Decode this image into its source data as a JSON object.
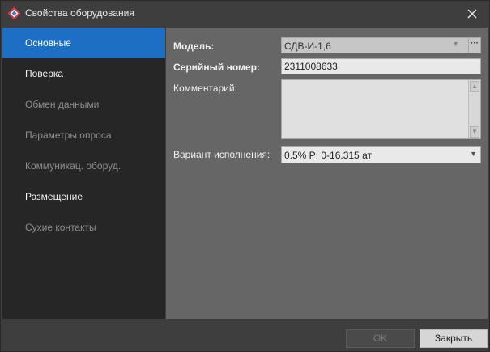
{
  "window": {
    "title": "Свойства оборудования",
    "icon": "app-diamond-icon",
    "close_icon": "close-icon"
  },
  "sidebar": {
    "items": [
      {
        "label": "Основные",
        "state": "active"
      },
      {
        "label": "Поверка",
        "state": "enabled"
      },
      {
        "label": "Обмен данными",
        "state": "disabled"
      },
      {
        "label": "Параметры опроса",
        "state": "disabled"
      },
      {
        "label": "Коммуникац. оборуд.",
        "state": "disabled"
      },
      {
        "label": "Размещение",
        "state": "enabled"
      },
      {
        "label": "Сухие контакты",
        "state": "disabled"
      }
    ]
  },
  "form": {
    "model_label": "Модель:",
    "model_value": "СДВ-И-1,6",
    "model_browse": "···",
    "serial_label": "Серийный номер:",
    "serial_value": "2311008633",
    "comment_label": "Комментарий:",
    "comment_value": "",
    "variant_label": "Вариант исполнения:",
    "variant_value": "0.5% P: 0-16.315 ат"
  },
  "footer": {
    "ok_label": "OK",
    "close_label": "Закрыть"
  },
  "colors": {
    "accent": "#1d6fc3",
    "sidebar_bg": "#262626",
    "content_bg": "#666666"
  }
}
